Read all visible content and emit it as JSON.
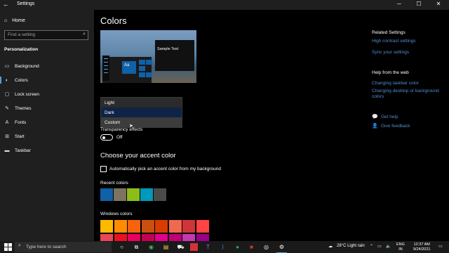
{
  "titlebar": {
    "back": "←",
    "title": "Settings",
    "minimize": "─",
    "maximize": "☐",
    "close": "✕"
  },
  "sidebar": {
    "home": {
      "icon": "⌂",
      "label": "Home"
    },
    "search_placeholder": "Find a setting",
    "search_icon": "⌕",
    "section": "Personalization",
    "items": [
      {
        "icon": "▭",
        "label": "Background"
      },
      {
        "icon": "◐",
        "label": "Colors"
      },
      {
        "icon": "▢",
        "label": "Lock screen"
      },
      {
        "icon": "✎",
        "label": "Themes"
      },
      {
        "icon": "A",
        "label": "Fonts"
      },
      {
        "icon": "⊞",
        "label": "Start"
      },
      {
        "icon": "▬",
        "label": "Taskbar"
      }
    ]
  },
  "main": {
    "title": "Colors",
    "preview": {
      "aa": "Aa",
      "sample_text": "Sample Text"
    },
    "color_mode_options": [
      "Light",
      "Dark",
      "Custom"
    ],
    "transparency_label": "Transparency effects",
    "transparency_state": "Off",
    "accent_heading": "Choose your accent color",
    "auto_pick_label": "Automatically pick an accent color from my background",
    "recent_label": "Recent colors",
    "recent_colors": [
      "#0f61a8",
      "#7e735f",
      "#8cbd18",
      "#0099bc",
      "#4c4a48"
    ],
    "windows_label": "Windows colors",
    "windows_colors": [
      "#ffb900",
      "#ff8c00",
      "#f7630c",
      "#ca5010",
      "#da3b01",
      "#ef6950",
      "#d13438",
      "#ff4343",
      "#e74856",
      "#e81123",
      "#ea005e",
      "#c30052",
      "#e3008c",
      "#bf0077",
      "#c239b3",
      "#9a0089"
    ]
  },
  "related": {
    "heading": "Related Settings",
    "links": [
      "High contrast settings",
      "Sync your settings"
    ],
    "help_heading": "Help from the web",
    "help_links": [
      "Changing taskbar color",
      "Changing desktop or background",
      "colors"
    ],
    "get_help": "Get help",
    "give_feedback": "Give feedback"
  },
  "taskbar": {
    "search_placeholder": "Type here to search",
    "weather": "28°C  Light rain",
    "lang": "ENG",
    "region": "IN",
    "time": "12:37 AM",
    "date": "9/24/2021"
  }
}
